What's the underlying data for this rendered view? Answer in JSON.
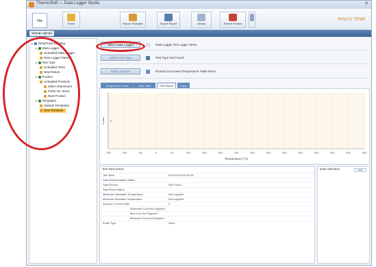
{
  "app": {
    "title": "ThermoSoft — Data Logger Studio",
    "brand": "RINCO TEMP"
  },
  "ribbon": {
    "file_label": "File",
    "buttons": [
      {
        "label": "Home",
        "icon": "home-icon",
        "color": "#e6b23a"
      },
      {
        "label": "Report Template",
        "icon": "report-icon",
        "color": "#d59a3a"
      },
      {
        "label": "Export Report",
        "icon": "export-icon",
        "color": "#5a7fb0"
      },
      {
        "label": "Library",
        "icon": "library-icon",
        "color": "#9fb4cf"
      },
      {
        "label": "Search Profiles",
        "icon": "search-profile-icon",
        "color": "#c2453a"
      }
    ]
  },
  "subbar": {
    "pill_label": "Start",
    "pill_action": "Upload"
  },
  "tree": {
    "items": [
      {
        "label": "TempTrack Building",
        "indent": 0,
        "icon_color": "#4a7ab8"
      },
      {
        "label": "Data Logger",
        "indent": 1,
        "icon_color": "#3e8a3e"
      },
      {
        "label": "Unloaded Data Logger",
        "indent": 2,
        "icon_color": "#e0a030"
      },
      {
        "label": "New Logger Return",
        "indent": 2,
        "icon_color": "#e0a030"
      },
      {
        "label": "Test Type",
        "indent": 1,
        "icon_color": "#3e8a3e"
      },
      {
        "label": "Unloaded Tests",
        "indent": 2,
        "icon_color": "#e0a030"
      },
      {
        "label": "New Return",
        "indent": 2,
        "icon_color": "#e0a030"
      },
      {
        "label": "Product",
        "indent": 1,
        "icon_color": "#3e8a3e"
      },
      {
        "label": "Unloaded Products",
        "indent": 2,
        "icon_color": "#e0a030"
      },
      {
        "label": "Other Attachment",
        "indent": 3,
        "icon_color": "#e0a030"
      },
      {
        "label": "Pulse No. Items",
        "indent": 3,
        "icon_color": "#e0a030"
      },
      {
        "label": "New Product",
        "indent": 3,
        "icon_color": "#e0a030"
      },
      {
        "label": "Templates",
        "indent": 1,
        "icon_color": "#3e8a3e"
      },
      {
        "label": "Sample Templates",
        "indent": 2,
        "icon_color": "#e0a030"
      },
      {
        "label": "New Template",
        "indent": 2,
        "icon_color": "#e0a030",
        "selected": true
      }
    ]
  },
  "form": {
    "row1": {
      "button": "Select Data Logger",
      "text": "Data Logger Not Logger Items"
    },
    "row2": {
      "button": "Select Test Type",
      "text": "Test Type Not Found"
    },
    "row3": {
      "button": "Select Product",
      "text": "Product Document Temperature Table Items"
    }
  },
  "tabs": [
    "Temperature Chart",
    "Data Table",
    "Test Report",
    "Export"
  ],
  "chart_data": {
    "type": "line",
    "title": "",
    "xlabel": "Temperature (°C)",
    "ylabel": "Count",
    "x_ticks": [
      "-150",
      "-100",
      "-50",
      "0",
      "50",
      "100",
      "150",
      "200",
      "250",
      "300",
      "350",
      "400",
      "450",
      "500",
      "550",
      "600",
      "650"
    ],
    "y_marker": "0",
    "series": [],
    "grid": true,
    "bg_color": "#fdf6ec"
  },
  "summary": {
    "title": "Test Description",
    "rows": [
      {
        "key": "Test Start",
        "value": "01/01/2015 00:00:00",
        "indent": 0
      },
      {
        "key": "Data Read Analysis Status",
        "value": "",
        "indent": 0
      },
      {
        "key": "Data Source",
        "value": "Not Found",
        "indent": 0
      },
      {
        "key": "Data Read Status",
        "value": "",
        "indent": 0
      },
      {
        "key": "Maximum Allowable Temperature",
        "value": "Not supplied",
        "indent": 0
      },
      {
        "key": "Minimum Allowable Temperature",
        "value": "Not supplied",
        "indent": 0
      },
      {
        "key": "Number of Test Points",
        "value": "0",
        "indent": 0
      },
      {
        "key": "Maximum Cool Not Supplied",
        "value": "",
        "indent": 40
      },
      {
        "key": "Mid Cool Not Supplied",
        "value": "",
        "indent": 40
      },
      {
        "key": "Minimum Cool Not Supplied",
        "value": "",
        "indent": 40
      },
      {
        "key": "Email Type",
        "value": "None",
        "indent": 0
      }
    ]
  },
  "side_panel": {
    "title": "Data Selection",
    "button": "Add"
  }
}
